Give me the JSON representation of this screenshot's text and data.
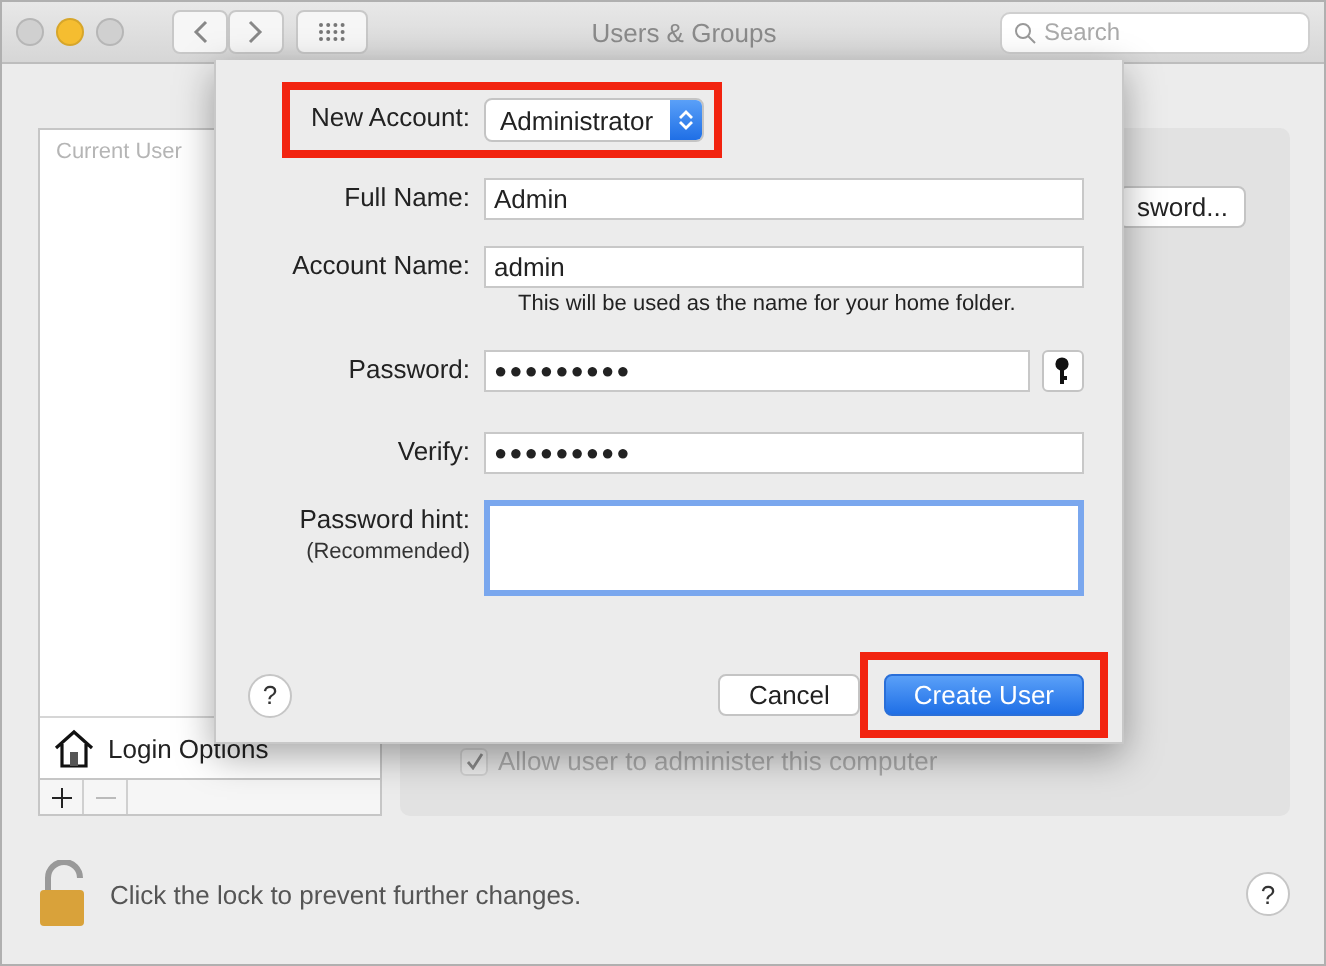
{
  "window": {
    "title": "Users & Groups",
    "search": {
      "placeholder": "Search"
    }
  },
  "user_list": {
    "header": "Current User",
    "login_options": "Login Options"
  },
  "detail": {
    "button": "sword...",
    "admin_checkbox": {
      "label": "Allow user to administer this computer",
      "checked": true,
      "disabled": true
    }
  },
  "lock_text": "Click the lock to prevent further changes.",
  "help": "?",
  "sheet": {
    "help": "?",
    "new_account": {
      "label": "New Account:",
      "value": "Administrator",
      "highlighted": true
    },
    "fields": [
      {
        "label": "Full Name:",
        "value": "Admin",
        "kind": "text"
      },
      {
        "label": "Account Name:",
        "value": "admin",
        "kind": "text",
        "note": "This will be used as the name for your home folder."
      },
      {
        "label": "Password:",
        "value": "●●●●●●●●●",
        "kind": "password"
      },
      {
        "label": "Verify:",
        "value": "●●●●●●●●●",
        "kind": "text"
      },
      {
        "label": "Password hint:",
        "sublabel": "(Recommended)",
        "kind": "area",
        "focused": true
      }
    ],
    "buttons": [
      {
        "label": "Cancel",
        "kind": "normal",
        "highlighted": false
      },
      {
        "label": "Create User",
        "kind": "default",
        "highlighted": true
      }
    ]
  }
}
